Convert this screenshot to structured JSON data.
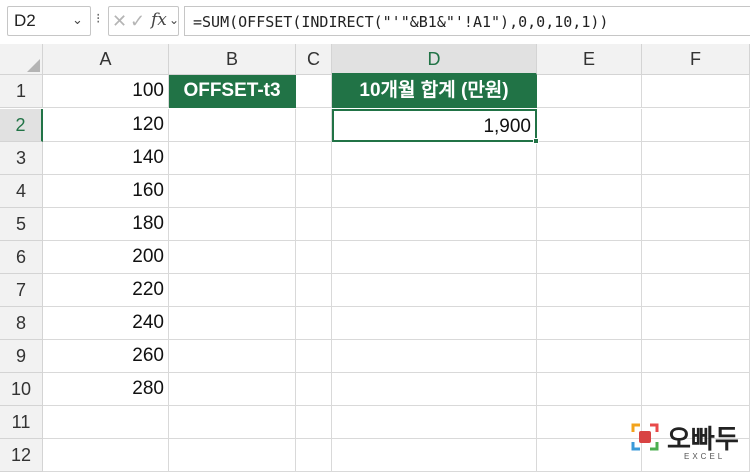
{
  "name_box": {
    "value": "D2"
  },
  "formula_bar": {
    "cancel_glyph": "✕",
    "enter_glyph": "✓",
    "fx_label": "fx",
    "formula": "=SUM(OFFSET(INDIRECT(\"'\"&B1&\"'!A1\"),0,0,10,1))"
  },
  "columns": [
    "A",
    "B",
    "C",
    "D",
    "E",
    "F"
  ],
  "selected_column": "D",
  "rows": [
    "1",
    "2",
    "3",
    "4",
    "5",
    "6",
    "7",
    "8",
    "9",
    "10",
    "11",
    "12"
  ],
  "selected_row": "2",
  "cells": {
    "A": [
      "100",
      "120",
      "140",
      "160",
      "180",
      "200",
      "220",
      "240",
      "260",
      "280"
    ],
    "B1": "OFFSET-t3",
    "D1": "10개월 합계 (만원)",
    "D2": "1,900"
  },
  "colors": {
    "accent": "#217346",
    "header_fill": "#217346"
  },
  "logo": {
    "name": "오빠두",
    "sub": "EXCEL"
  }
}
